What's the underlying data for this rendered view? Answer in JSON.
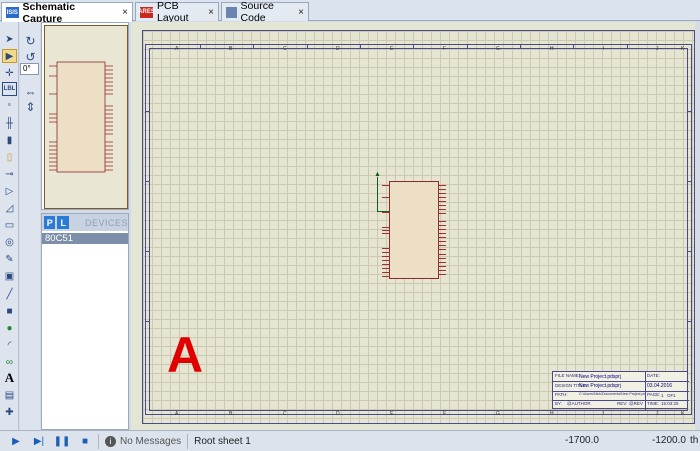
{
  "tabs": [
    {
      "label": "Schematic Capture",
      "icon": "ISIS",
      "close": "×"
    },
    {
      "label": "PCB Layout",
      "icon": "ARES",
      "close": "×"
    },
    {
      "label": "Source Code",
      "icon": "code",
      "close": "×"
    }
  ],
  "toolbar": {
    "rotation_value": "0°"
  },
  "devices": {
    "p_button": "P",
    "l_button": "L",
    "title": "DEVICES",
    "items": [
      "80C51"
    ]
  },
  "canvas": {
    "column_labels": [
      "A",
      "B",
      "C",
      "D",
      "E",
      "F",
      "G",
      "H",
      "I",
      "J",
      "K"
    ],
    "marker": "A",
    "title_block": {
      "file_label": "FILE NAME:",
      "file_value": "New Project.pdsprj",
      "design_label": "DESIGN TITLE:",
      "design_value": "New Project.pdsprj",
      "path_label": "PATH:",
      "path_value": "C:\\Users\\Nick\\Documents\\New Project.pdsprj",
      "by_label": "BY:",
      "by_value": "@AUTHOR",
      "rev_label": "REV:",
      "rev_value": "@REV",
      "date_label": "DATE:",
      "date_value": "03.04.2016",
      "page_label": "PAGE:",
      "page_value": "1",
      "of_label": "OF",
      "of_value": "1",
      "time_label": "TIME:",
      "time_value": "15:03:25"
    }
  },
  "status": {
    "messages": "No Messages",
    "sheet": "Root sheet 1",
    "x": "-1700.0",
    "y": "-1200.0",
    "unit": "th"
  }
}
